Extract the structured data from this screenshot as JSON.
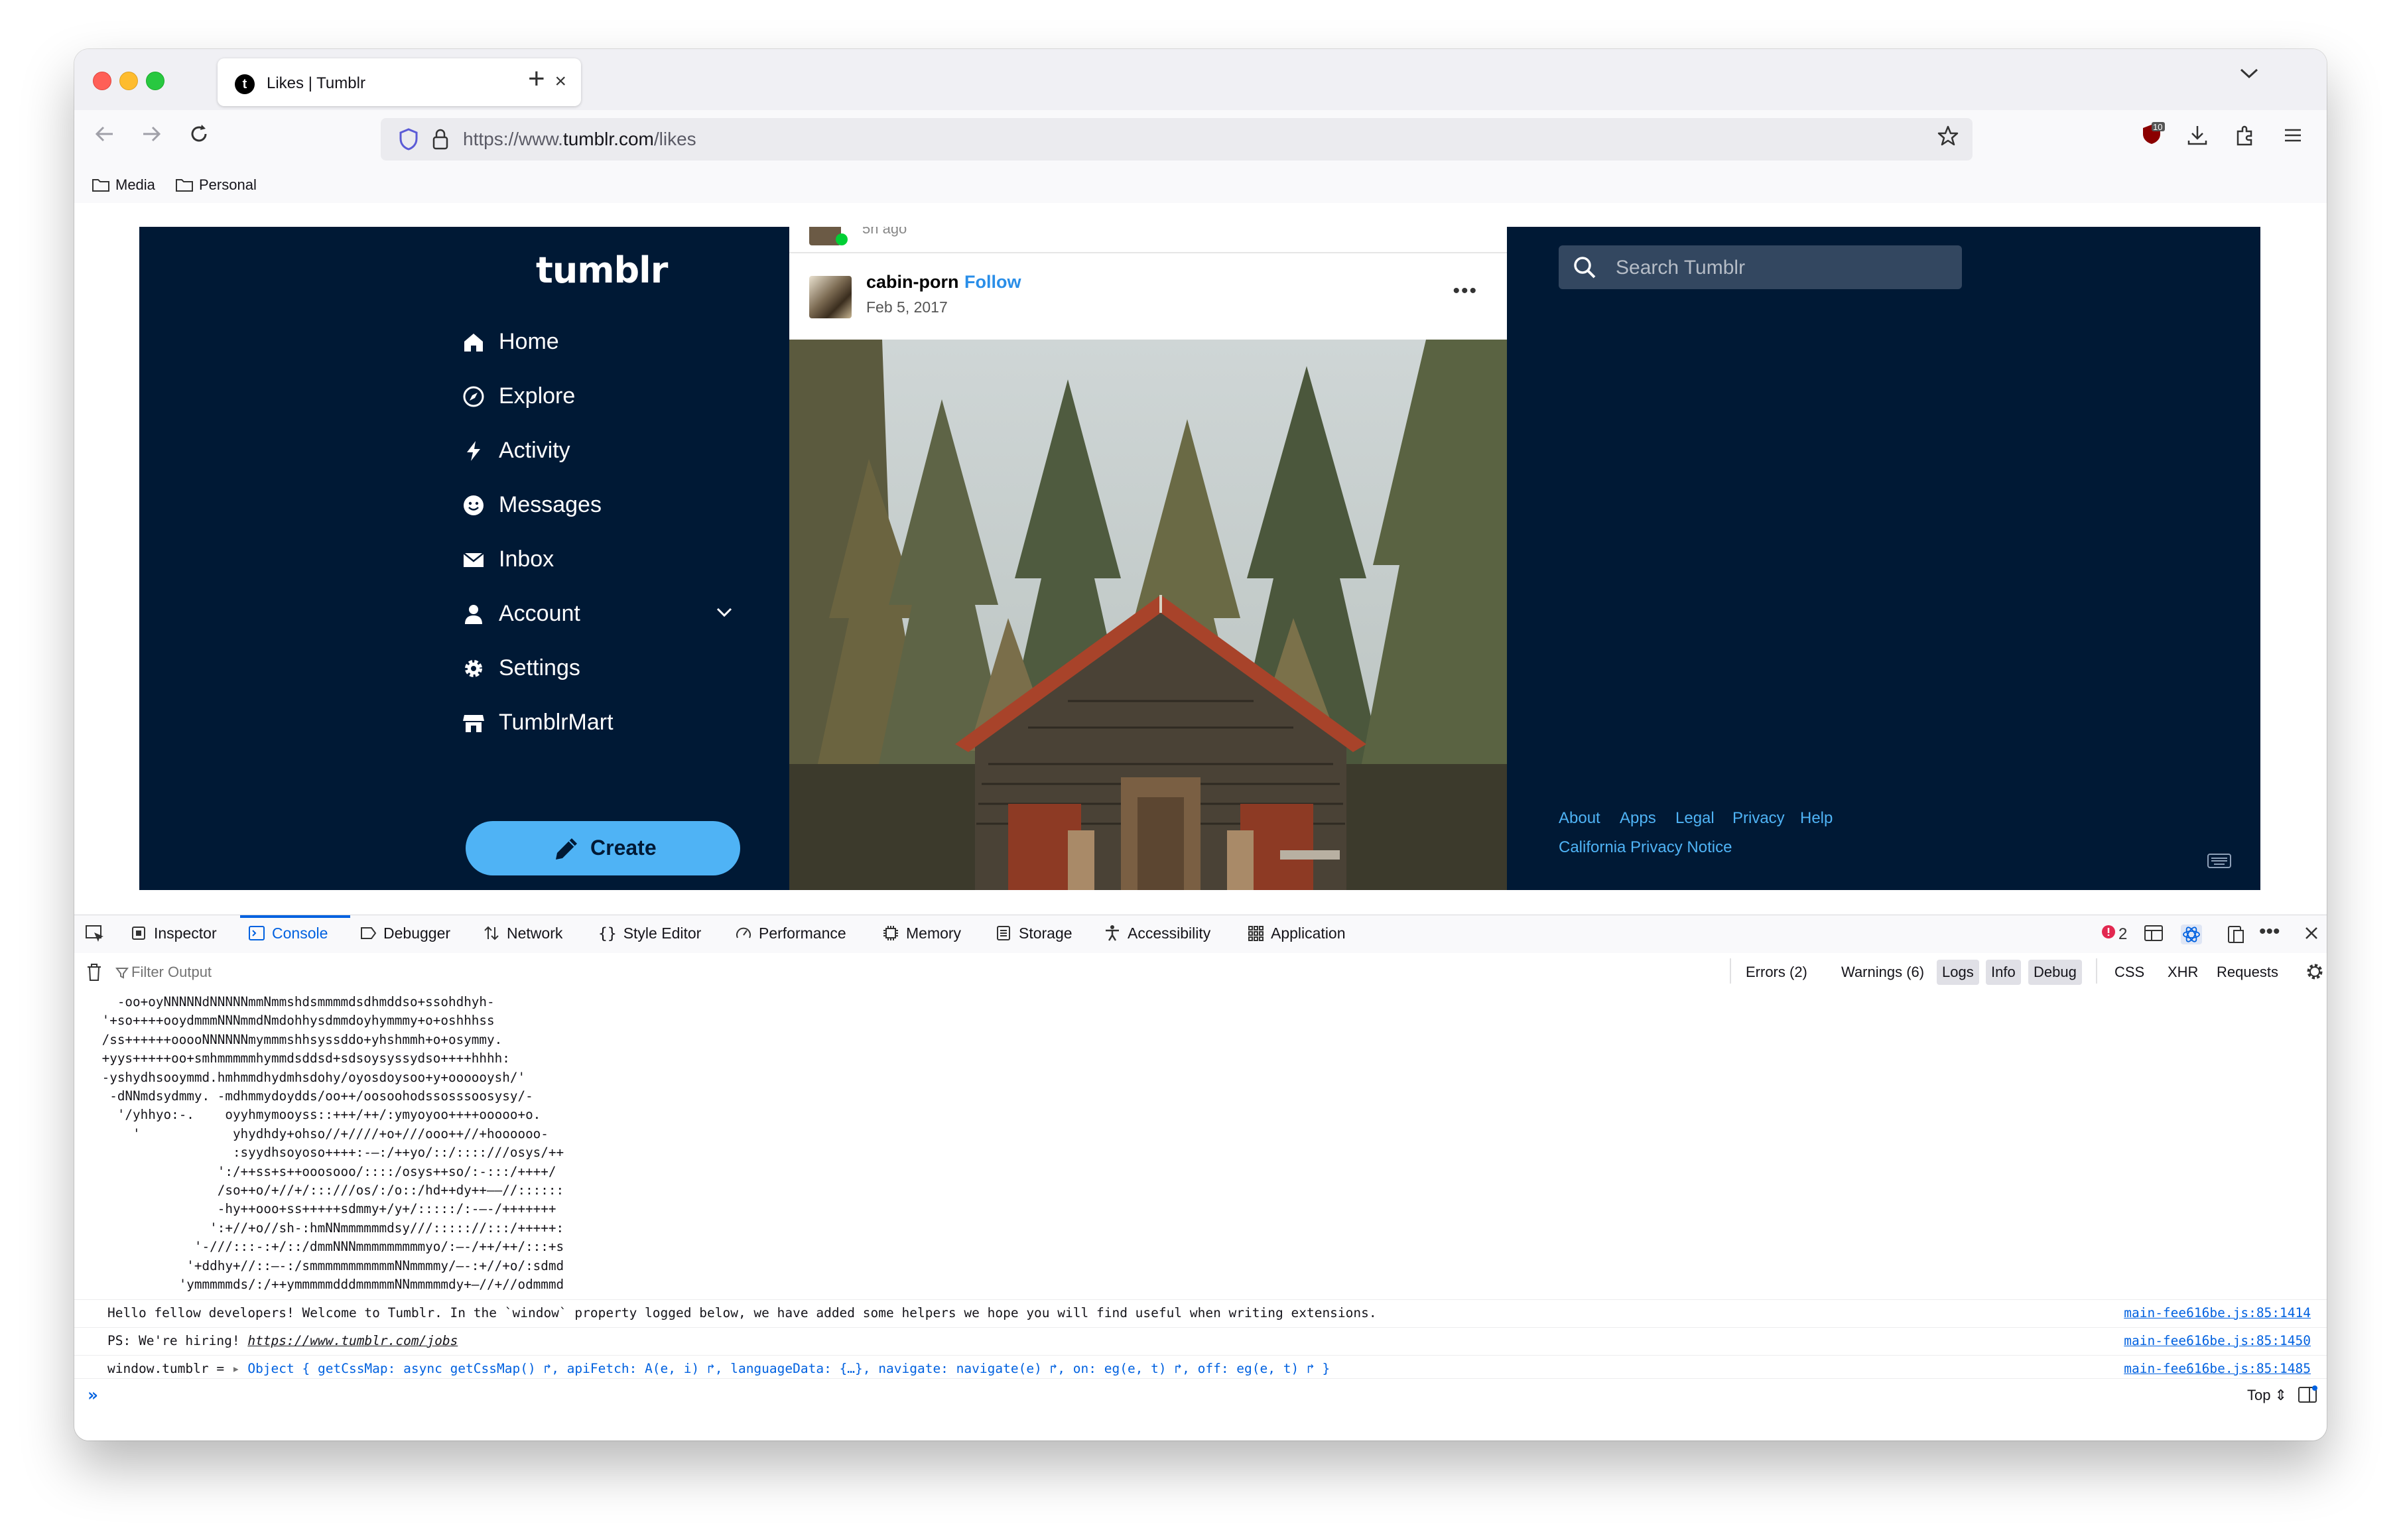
{
  "browser": {
    "tab_title": "Likes | Tumblr",
    "tab_favicon_letter": "t",
    "url_prefix": "https://www.",
    "url_domain": "tumblr.com",
    "url_path": "/likes",
    "extension_badge": "10",
    "bookmarks": [
      "Media",
      "Personal"
    ]
  },
  "tumblr": {
    "logo": "tumblr",
    "nav": [
      {
        "label": "Home",
        "icon": "home-icon"
      },
      {
        "label": "Explore",
        "icon": "compass-icon"
      },
      {
        "label": "Activity",
        "icon": "lightning-icon"
      },
      {
        "label": "Messages",
        "icon": "smiley-icon"
      },
      {
        "label": "Inbox",
        "icon": "envelope-icon"
      },
      {
        "label": "Account",
        "icon": "person-icon"
      },
      {
        "label": "Settings",
        "icon": "gear-icon"
      },
      {
        "label": "TumblrMart",
        "icon": "shop-icon"
      }
    ],
    "create_label": "Create",
    "previous_post_time": "5h ago",
    "post": {
      "username": "cabin-porn",
      "follow_label": "Follow",
      "date": "Feb 5, 2017",
      "more_label": "•••"
    },
    "search_placeholder": "Search Tumblr",
    "footer_links": [
      "About",
      "Apps",
      "Legal",
      "Privacy",
      "Help"
    ],
    "footer_link_2": "California Privacy Notice",
    "colors": {
      "background": "#001935",
      "accent": "#4fb3f5",
      "follow": "#2a8ee8"
    }
  },
  "devtools": {
    "tabs": [
      "Inspector",
      "Console",
      "Debugger",
      "Network",
      "Style Editor",
      "Performance",
      "Memory",
      "Storage",
      "Accessibility",
      "Application"
    ],
    "active_tab": "Console",
    "error_count": "2",
    "filter_placeholder": "Filter Output",
    "filters": [
      "Errors (2)",
      "Warnings (6)",
      "Logs",
      "Info",
      "Debug",
      "CSS",
      "XHR",
      "Requests"
    ],
    "ascii_art": [
      "   -oo+oyNNNNNdNNNNNmmNmmshdsmmmmdsdhmddso+ssohdhyh-",
      " '+so++++ooydmmmNNNmmdNmdohhysdmmdoyhymmmy+o+oshhhss",
      " /ss++++++ooooNNNNNNmymmmshhsyssddo+yhshmmh+o+osymmy.",
      " +yys+++++oo+smhmmmmmhymmdsddsd+sdsoysyssydso++++hhhh:",
      " -yshydhsooymmd.hmhmmdhydmhsdohy/oyosdoysoo+y+oooooysh/'",
      "  -dNNmdsydmmy. -mdhmmydoydds/oo++/oosoohodssosssoosysy/-",
      "   '/yhhyo:-.    oyyhmymooyss::+++/++/:ymyoyoo++++ooooo+o.",
      "     '            yhydhdy+ohso//+////+o+///ooo++//+hoooooo-",
      "                  :syydhsoyoso++++:-—:/++yo/::/::::///osys/++",
      "                ':/++ss+s++ooosooo/::::/osys++so/:-:::/++++/",
      "                /so++o/+//+/:::///os/:/o::/hd++dy++——//::::::",
      "                -hy++ooo+ss+++++sdmmy+/y+/:::::/:-—-/+++++++",
      "               ':+//+o//sh-:hmNNmmmmmmdsy///::::://:::/+++++:",
      "             '-///:::-:+/::/dmmNNNmmmmmmmmmyo/:—-/++/++/:::+s",
      "            '+ddhy+//::—-:/smmmmmmmmmmmNNmmmmy/—-:+//+o/:sdmd",
      "           'ymmmmmds/:/++ymmmmmdddmmmmmNNmmmmmdy+—//+//odmmmd"
    ],
    "logs": [
      {
        "message": "Hello fellow developers! Welcome to Tumblr. In the `window` property logged below, we have added some helpers we hope you will find useful when writing extensions.",
        "source": "main-fee616be.js:85:1414"
      },
      {
        "message_prefix": "PS: We're hiring! ",
        "message_link": "https://www.tumblr.com/jobs",
        "source": "main-fee616be.js:85:1450"
      },
      {
        "message_prefix": "window.tumblr = ",
        "object_preview": "Object { getCssMap: async getCssMap() ↱, apiFetch: A(e, i) ↱, languageData: {…}, navigate: navigate(e) ↱, on: eg(e, t) ↱, off: eg(e, t) ↱ }",
        "source": "main-fee616be.js:85:1485"
      }
    ],
    "context_selector": "Top ⇕"
  }
}
